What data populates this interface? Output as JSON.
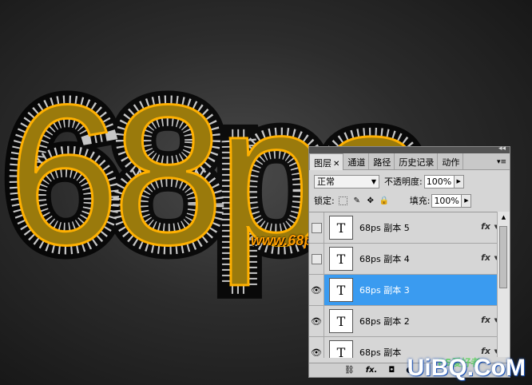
{
  "artwork": {
    "text": "68ps",
    "url": "www.68ps.com"
  },
  "panel": {
    "tabs": [
      {
        "label": "图层",
        "active": true
      },
      {
        "label": "通道"
      },
      {
        "label": "路径"
      },
      {
        "label": "历史记录"
      },
      {
        "label": "动作"
      }
    ],
    "blend_mode": "正常",
    "opacity_label": "不透明度:",
    "opacity_value": "100%",
    "lock_label": "锁定:",
    "fill_label": "填充:",
    "fill_value": "100%",
    "layers": [
      {
        "name": "68ps 副本 5",
        "thumb": "T",
        "visible": false,
        "selected": false,
        "fx": "fx"
      },
      {
        "name": "68ps 副本 4",
        "thumb": "T",
        "visible": false,
        "selected": false,
        "fx": "fx"
      },
      {
        "name": "68ps 副本 3",
        "thumb": "T",
        "visible": true,
        "selected": true,
        "fx": ""
      },
      {
        "name": "68ps 副本 2",
        "thumb": "T",
        "visible": true,
        "selected": false,
        "fx": "fx"
      },
      {
        "name": "68ps 副本",
        "thumb": "T",
        "visible": true,
        "selected": false,
        "fx": "fx"
      }
    ],
    "footer_icons": [
      "link-icon",
      "fx-icon",
      "mask-icon",
      "adjustment-icon"
    ],
    "footer_fx": "fx."
  },
  "watermark": {
    "text": "UiBQ.CoM",
    "small": "PS爱好者"
  },
  "colors": {
    "gold": "#9a7a0c",
    "glow": "#ffb000",
    "selection": "#3a9bf0"
  }
}
